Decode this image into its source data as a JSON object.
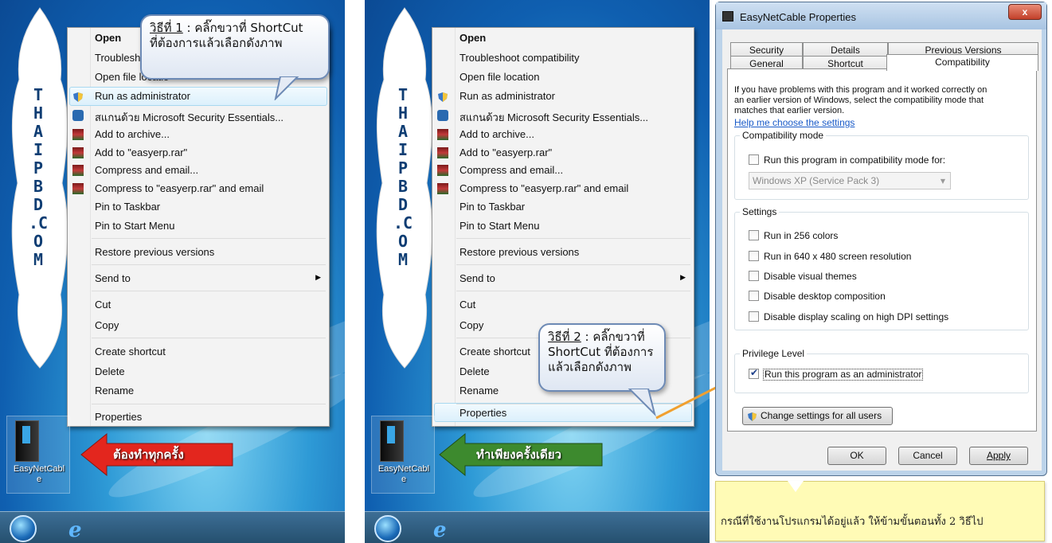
{
  "context_menu": {
    "items": [
      "Open",
      "Troubleshoot compatibility",
      "Open file location",
      "Run as administrator",
      "สแกนด้วย Microsoft Security Essentials...",
      "Add to archive...",
      "Add to \"easyerp.rar\"",
      "Compress and email...",
      "Compress to \"easyerp.rar\" and email",
      "Pin to Taskbar",
      "Pin to Start Menu",
      "Restore previous versions",
      "Send to",
      "Cut",
      "Copy",
      "Create shortcut",
      "Delete",
      "Rename",
      "Properties"
    ],
    "troubleshoot_partial": "Troublesho",
    "open_loc_partial": "Open file locatio",
    "create_shortcut_partial": "Create shortcut"
  },
  "side_banner": {
    "letters": [
      "T",
      "H",
      "A",
      "I",
      "P",
      "B",
      "D",
      ".C",
      "O",
      "M"
    ]
  },
  "desktop_icon": {
    "label_line1": "EasyNetCabl",
    "label_line2": "e"
  },
  "callouts": {
    "step1_prefix": "วิธีที่ 1",
    "step1_rest": " : คลิ๊กขวาที่ ShortCut",
    "step1_line2": "ที่ต้องการแล้วเลือกดังภาพ",
    "step2_prefix": "วิธีที่ 2",
    "step2_rest": " : คลิ๊กขวาที่",
    "step2_line2": "ShortCut ที่ต้องการ",
    "step2_line3": "แล้วเลือกดังภาพ"
  },
  "arrows": {
    "red": "ต้องทำทุกครั้ง",
    "green": "ทำเพียงครั้งเดียว"
  },
  "dialog": {
    "title": "EasyNetCable Properties",
    "close": "x",
    "tabs_row1": [
      "Security",
      "Details",
      "Previous Versions"
    ],
    "tabs_row2": [
      "General",
      "Shortcut",
      "Compatibility"
    ],
    "intro_lines": [
      "If you have problems with this program and it worked correctly on",
      "an earlier version of Windows, select the compatibility mode that",
      "matches that earlier version."
    ],
    "help_link": "Help me choose the settings",
    "compat_group": "Compatibility mode",
    "compat_check": "Run this program in compatibility mode for:",
    "compat_select": "Windows XP (Service Pack 3)",
    "settings_group": "Settings",
    "settings": [
      "Run in 256 colors",
      "Run in 640 x 480 screen resolution",
      "Disable visual themes",
      "Disable desktop composition",
      "Disable display scaling on high DPI settings"
    ],
    "privilege_group": "Privilege Level",
    "privilege_check": "Run this program as an administrator",
    "change_all": "Change settings for all users",
    "ok": "OK",
    "cancel": "Cancel",
    "apply": "Apply"
  },
  "note": "กรณีที่ใช้งานโปรแกรมได้อยู่แล้ว ให้ข้ามขั้นตอนทั้ง 2 วิธีไป",
  "colors": {
    "red_arrow": "#e3261e",
    "green_arrow": "#3d8a2e",
    "callout_border": "#6d8ab5",
    "note_bg": "#fffbb6"
  }
}
